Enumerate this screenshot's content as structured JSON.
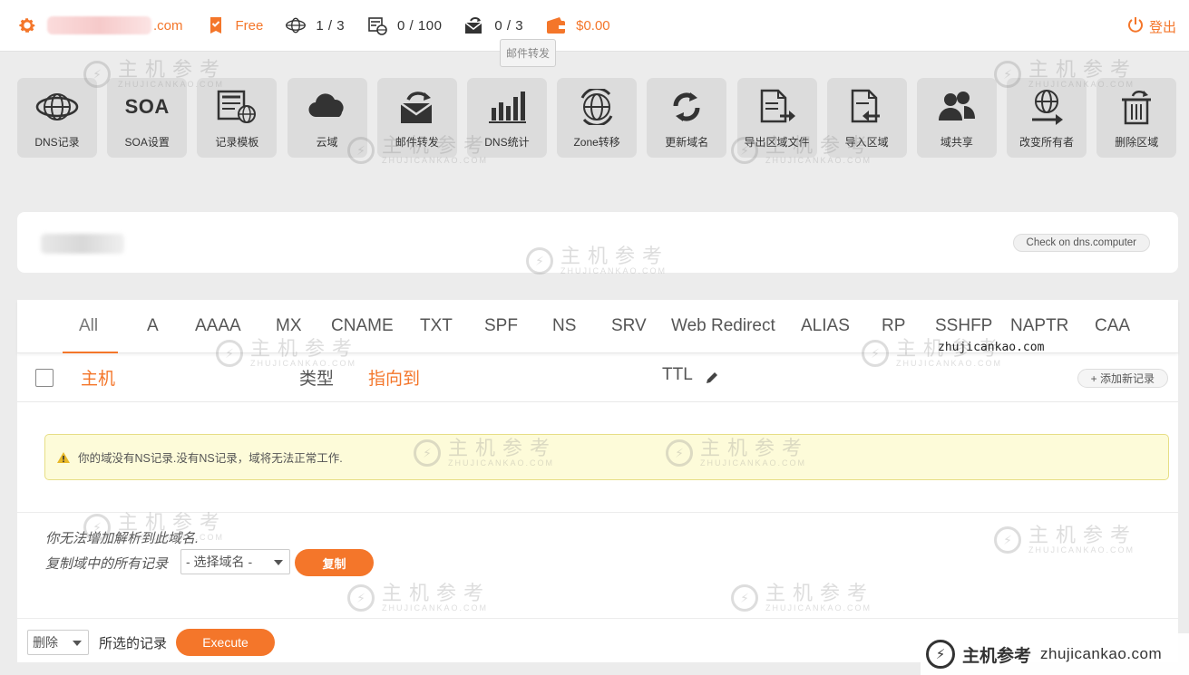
{
  "topbar": {
    "account_suffix": ".com",
    "plan": "Free",
    "domains_count": "1 / 3",
    "records_count": "0 / 100",
    "mail_forward_count": "0 / 3",
    "balance": "$0.00",
    "logout": "登出",
    "tooltip": "邮件转发",
    "accent_color": "#f4762a"
  },
  "tools": [
    {
      "label": "DNS记录",
      "icon": "globe-icon"
    },
    {
      "label": "SOA设置",
      "icon": "soa-icon",
      "icon_text": "SOA"
    },
    {
      "label": "记录模板",
      "icon": "template-icon"
    },
    {
      "label": "云域",
      "icon": "cloud-icon"
    },
    {
      "label": "邮件转发",
      "icon": "mail-forward-icon"
    },
    {
      "label": "DNS统计",
      "icon": "bar-chart-icon"
    },
    {
      "label": "Zone转移",
      "icon": "globe-transfer-icon"
    },
    {
      "label": "更新域名",
      "icon": "refresh-icon"
    },
    {
      "label": "导出区域文件",
      "icon": "export-file-icon"
    },
    {
      "label": "导入区域",
      "icon": "import-file-icon"
    },
    {
      "label": "域共享",
      "icon": "users-icon"
    },
    {
      "label": "改变所有者",
      "icon": "change-owner-icon"
    },
    {
      "label": "删除区域",
      "icon": "trash-icon"
    }
  ],
  "domain_card": {
    "check_button": "Check on dns.computer"
  },
  "record_tabs": [
    "All",
    "A",
    "AAAA",
    "MX",
    "CNAME",
    "TXT",
    "SPF",
    "NS",
    "SRV",
    "Web Redirect",
    "ALIAS",
    "RP",
    "SSHFP",
    "NAPTR",
    "CAA"
  ],
  "table_header": {
    "host": "主机",
    "type": "类型",
    "points_to": "指向到",
    "ttl": "TTL",
    "add_record": "+ 添加新记录"
  },
  "alert": {
    "message": "你的域没有NS记录.没有NS记录，域将无法正常工作."
  },
  "copy_section": {
    "cannot_add": "你无法增加解析到此域名.",
    "copy_label": "复制域中的所有记录",
    "select_placeholder": "- 选择域名 -",
    "copy_button": "复制"
  },
  "bulk": {
    "action_value": "删除",
    "label": "所选的记录",
    "execute": "Execute"
  },
  "watermark": {
    "cn": "主机参考",
    "en": "ZHUJICANKAO.COM",
    "domain": "zhujicankao.com",
    "mono": "zhujicankao.com"
  }
}
